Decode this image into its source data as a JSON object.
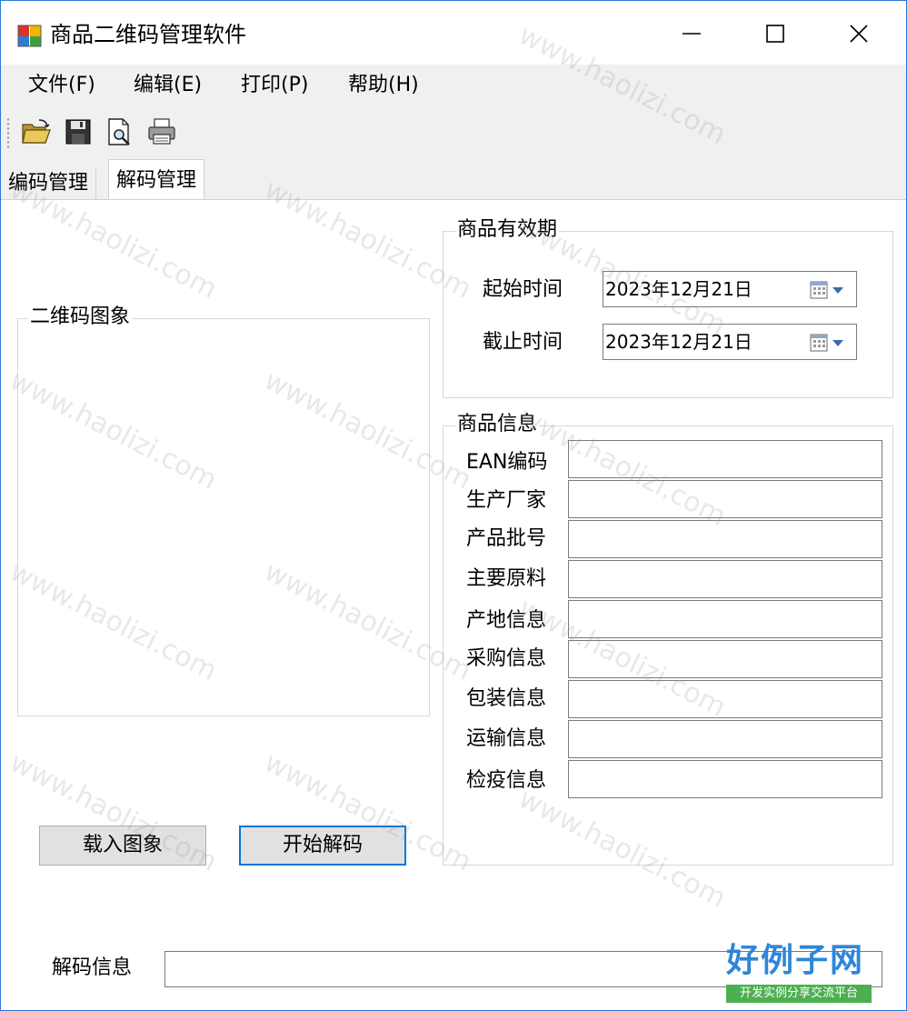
{
  "window": {
    "title": "商品二维码管理软件",
    "controls": {
      "minimize": "minimize-icon",
      "maximize": "maximize-icon",
      "close": "close-icon"
    }
  },
  "menu": [
    {
      "label": "文件(F)"
    },
    {
      "label": "编辑(E)"
    },
    {
      "label": "打印(P)"
    },
    {
      "label": "帮助(H)"
    }
  ],
  "toolbar": {
    "buttons": [
      {
        "icon": "open-folder-icon"
      },
      {
        "icon": "save-icon"
      },
      {
        "icon": "print-preview-icon"
      },
      {
        "icon": "print-icon"
      }
    ]
  },
  "tabs": [
    {
      "label": "编码管理",
      "active": false
    },
    {
      "label": "解码管理",
      "active": true
    }
  ],
  "qr_group": {
    "title": "二维码图象"
  },
  "validity": {
    "title": "商品有效期",
    "start": {
      "label": "起始时间",
      "value": "2023年12月21日"
    },
    "end": {
      "label": "截止时间",
      "value": "2023年12月21日"
    }
  },
  "info": {
    "title": "商品信息",
    "fields": [
      {
        "label": "EAN编码",
        "value": ""
      },
      {
        "label": "生产厂家",
        "value": ""
      },
      {
        "label": "产品批号",
        "value": ""
      },
      {
        "label": "主要原料",
        "value": ""
      },
      {
        "label": "产地信息",
        "value": ""
      },
      {
        "label": "采购信息",
        "value": ""
      },
      {
        "label": "包装信息",
        "value": ""
      },
      {
        "label": "运输信息",
        "value": ""
      },
      {
        "label": "检疫信息",
        "value": ""
      }
    ]
  },
  "buttons": {
    "load": "载入图象",
    "decode": "开始解码"
  },
  "decode_info": {
    "label": "解码信息",
    "value": ""
  },
  "watermark": {
    "text": "www.haolizi.com"
  },
  "logo": {
    "main": "好例子网",
    "sub": "开发实例分享交流平台"
  },
  "colors": {
    "accent": "#0078d7",
    "window_border": "#2b78d6",
    "logo_blue": "#2e86d8",
    "logo_green": "#4caf50"
  }
}
